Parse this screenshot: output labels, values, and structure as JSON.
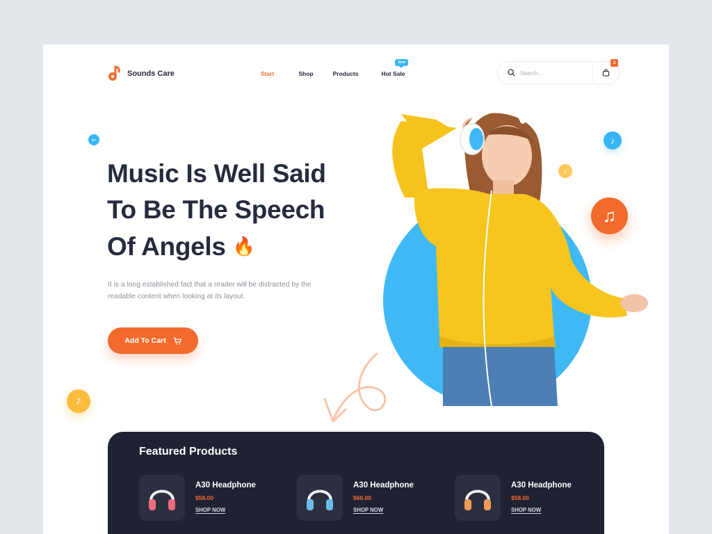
{
  "brand": {
    "name": "Sounds Care"
  },
  "nav": {
    "items": [
      {
        "label": "Start",
        "active": true
      },
      {
        "label": "Shop"
      },
      {
        "label": "Products"
      },
      {
        "label": "Hot Sale",
        "badge": "New"
      }
    ]
  },
  "search": {
    "placeholder": "Search..."
  },
  "cart": {
    "count": "3"
  },
  "hero": {
    "title_line1": "Music Is Well Said",
    "title_line2": "To Be The Speech",
    "title_line3": "Of Angels",
    "title_emoji": "🔥",
    "description": "It is a long established fact that a reader will be distracted by the readable content when looking at its layout.",
    "cta_label": "Add To Cart"
  },
  "featured": {
    "title": "Featured Products",
    "products": [
      {
        "name": "A30 Headphone",
        "price": "$58.00",
        "link": "SHOP NOW",
        "color": "#f06a7a"
      },
      {
        "name": "A30 Headphone",
        "price": "$66.00",
        "link": "SHOP NOW",
        "color": "#6bbde8"
      },
      {
        "name": "A30 Headphone",
        "price": "$58.00",
        "link": "SHOP NOW",
        "color": "#f29a55"
      }
    ]
  },
  "colors": {
    "accent": "#f26b2d",
    "blue": "#3fb9f6",
    "yellow": "#fbbd3c",
    "dark": "#1f2233"
  },
  "icons": [
    "music-note-icon",
    "search-icon",
    "shopping-bag-icon",
    "cart-icon",
    "fire-emoji",
    "headphone-icon"
  ]
}
